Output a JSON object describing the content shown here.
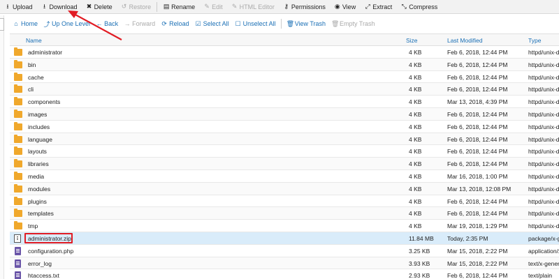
{
  "toolbar": {
    "upload": "Upload",
    "download": "Download",
    "delete": "Delete",
    "restore": "Restore",
    "rename": "Rename",
    "edit": "Edit",
    "html_editor": "HTML Editor",
    "permissions": "Permissions",
    "view": "View",
    "extract": "Extract",
    "compress": "Compress"
  },
  "nav": {
    "home": "Home",
    "up_one_level": "Up One Level",
    "back": "Back",
    "forward": "Forward",
    "reload": "Reload",
    "select_all": "Select All",
    "unselect_all": "Unselect All",
    "view_trash": "View Trash",
    "empty_trash": "Empty Trash"
  },
  "columns": {
    "name": "Name",
    "size": "Size",
    "last_modified": "Last Modified",
    "type": "Type"
  },
  "files": [
    {
      "name": "administrator",
      "size": "4 KB",
      "modified": "Feb 6, 2018, 12:44 PM",
      "type": "httpd/unix-directory",
      "icon": "folder-icon"
    },
    {
      "name": "bin",
      "size": "4 KB",
      "modified": "Feb 6, 2018, 12:44 PM",
      "type": "httpd/unix-directory",
      "icon": "folder-icon"
    },
    {
      "name": "cache",
      "size": "4 KB",
      "modified": "Feb 6, 2018, 12:44 PM",
      "type": "httpd/unix-directory",
      "icon": "folder-icon"
    },
    {
      "name": "cli",
      "size": "4 KB",
      "modified": "Feb 6, 2018, 12:44 PM",
      "type": "httpd/unix-directory",
      "icon": "folder-icon"
    },
    {
      "name": "components",
      "size": "4 KB",
      "modified": "Mar 13, 2018, 4:39 PM",
      "type": "httpd/unix-directory",
      "icon": "folder-icon"
    },
    {
      "name": "images",
      "size": "4 KB",
      "modified": "Feb 6, 2018, 12:44 PM",
      "type": "httpd/unix-directory",
      "icon": "folder-icon"
    },
    {
      "name": "includes",
      "size": "4 KB",
      "modified": "Feb 6, 2018, 12:44 PM",
      "type": "httpd/unix-directory",
      "icon": "folder-icon"
    },
    {
      "name": "language",
      "size": "4 KB",
      "modified": "Feb 6, 2018, 12:44 PM",
      "type": "httpd/unix-directory",
      "icon": "folder-icon"
    },
    {
      "name": "layouts",
      "size": "4 KB",
      "modified": "Feb 6, 2018, 12:44 PM",
      "type": "httpd/unix-directory",
      "icon": "folder-icon"
    },
    {
      "name": "libraries",
      "size": "4 KB",
      "modified": "Feb 6, 2018, 12:44 PM",
      "type": "httpd/unix-directory",
      "icon": "folder-icon"
    },
    {
      "name": "media",
      "size": "4 KB",
      "modified": "Mar 16, 2018, 1:00 PM",
      "type": "httpd/unix-directory",
      "icon": "folder-icon"
    },
    {
      "name": "modules",
      "size": "4 KB",
      "modified": "Mar 13, 2018, 12:08 PM",
      "type": "httpd/unix-directory",
      "icon": "folder-icon"
    },
    {
      "name": "plugins",
      "size": "4 KB",
      "modified": "Feb 6, 2018, 12:44 PM",
      "type": "httpd/unix-directory",
      "icon": "folder-icon"
    },
    {
      "name": "templates",
      "size": "4 KB",
      "modified": "Feb 6, 2018, 12:44 PM",
      "type": "httpd/unix-directory",
      "icon": "folder-icon"
    },
    {
      "name": "tmp",
      "size": "4 KB",
      "modified": "Mar 19, 2018, 1:29 PM",
      "type": "httpd/unix-directory",
      "icon": "folder-icon"
    },
    {
      "name": "administrator.zip",
      "size": "11.84 MB",
      "modified": "Today, 2:35 PM",
      "type": "package/x-generic",
      "icon": "zip-file-icon",
      "selected": true
    },
    {
      "name": "configuration.php",
      "size": "3.25 KB",
      "modified": "Mar 15, 2018, 2:22 PM",
      "type": "application/x-httpd-php",
      "icon": "php-file-icon"
    },
    {
      "name": "error_log",
      "size": "3.93 KB",
      "modified": "Mar 15, 2018, 2:22 PM",
      "type": "text/x-generic",
      "icon": "text-file-icon"
    },
    {
      "name": "htaccess.txt",
      "size": "2.93 KB",
      "modified": "Feb 6, 2018, 12:44 PM",
      "type": "text/plain",
      "icon": "text-file-icon"
    }
  ],
  "colors": {
    "link_blue": "#1a6fb5",
    "folder_orange": "#f0a82c",
    "selected_row": "#d9ecfa",
    "annotation_red": "#e11c24"
  }
}
